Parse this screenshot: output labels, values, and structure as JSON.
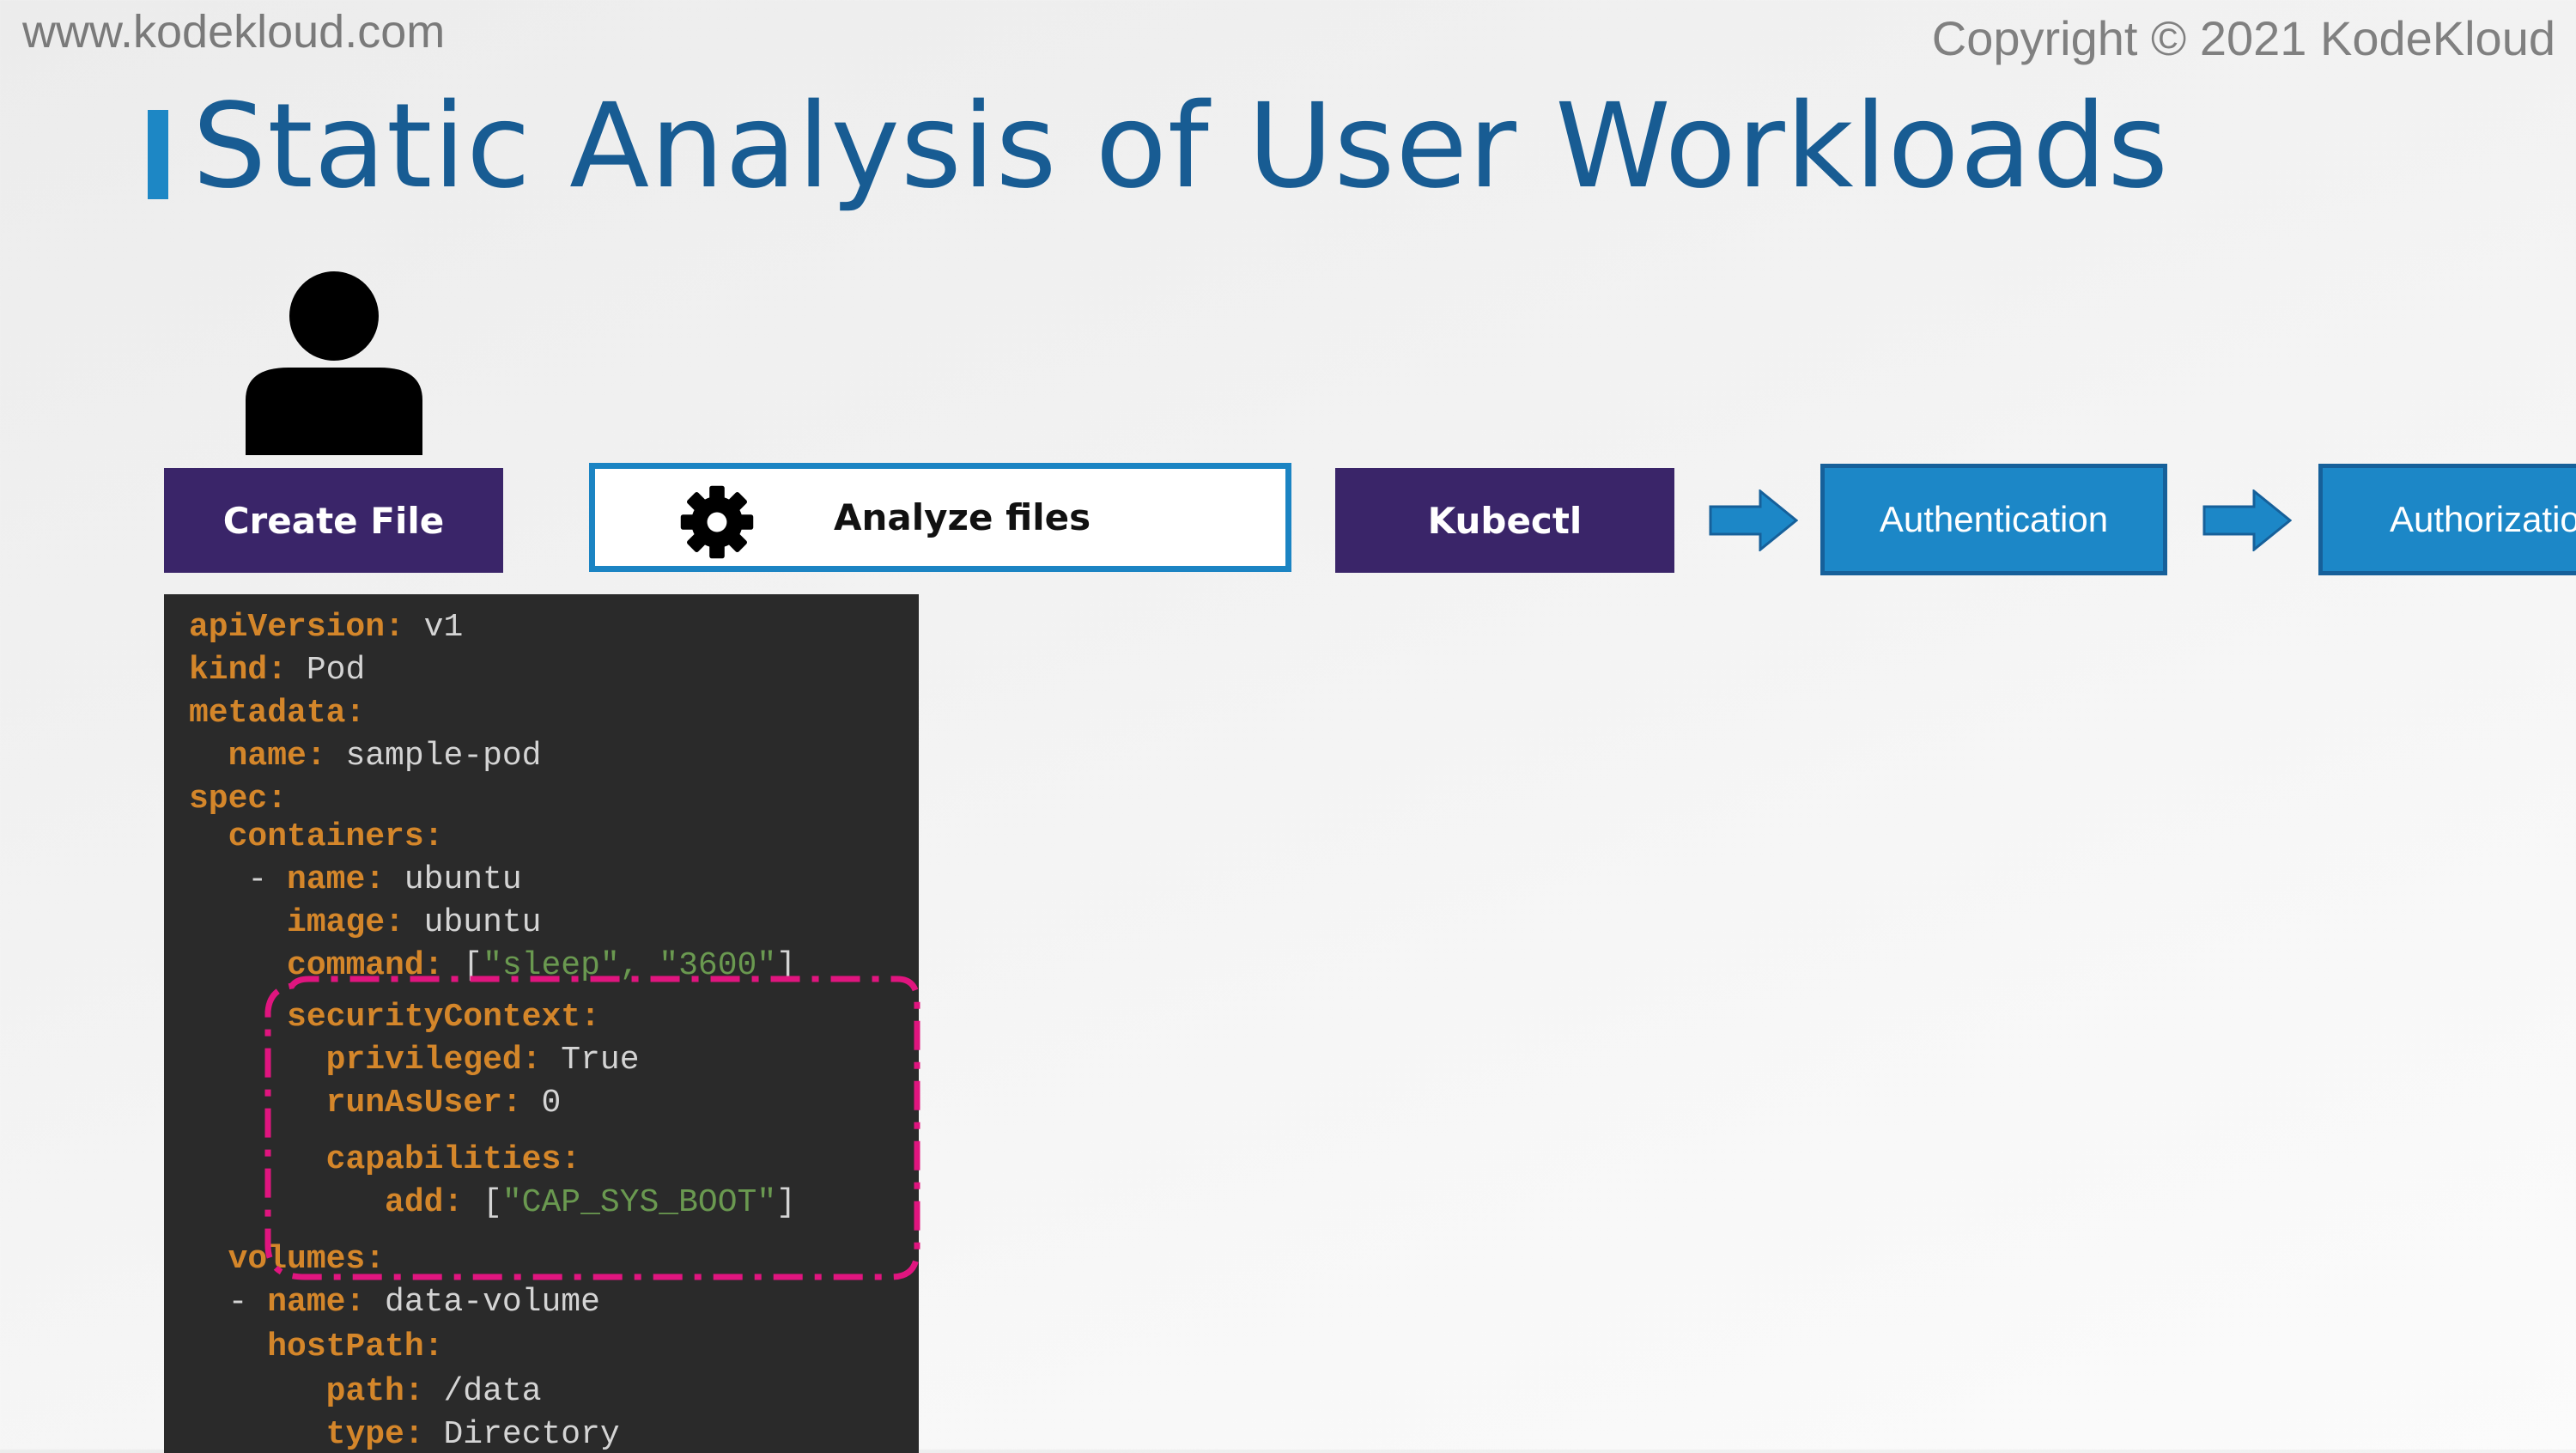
{
  "header": {
    "site_url": "www.kodekloud.com",
    "copyright": "Copyright © 2021 KodeKloud"
  },
  "slide": {
    "title": "Static Analysis of User Workloads"
  },
  "flow": {
    "create_file": "Create File",
    "analyze_files": "Analyze files",
    "kubectl": "Kubectl",
    "authentication": "Authentication",
    "authorization": "Authorizatio"
  },
  "code": {
    "lines": [
      {
        "indent": "",
        "key": "apiVersion:",
        "value": " v1"
      },
      {
        "indent": "",
        "key": "kind:",
        "value": " Pod"
      },
      {
        "indent": "",
        "key": "metadata:",
        "value": ""
      },
      {
        "indent": "  ",
        "key": "name:",
        "value": " sample-pod"
      },
      {
        "indent": "",
        "key": "spec:",
        "value": ""
      },
      {
        "indent": "  ",
        "key": "containers:",
        "value": ""
      },
      {
        "indent": "   - ",
        "key": "name:",
        "value": " ubuntu"
      },
      {
        "indent": "     ",
        "key": "image:",
        "value": " ubuntu"
      },
      {
        "indent": "     ",
        "key": "command:",
        "value_pre": " [",
        "string": "\"sleep\", \"3600\"",
        "value_post": "]"
      },
      {
        "indent": "     ",
        "key": "securityContext:",
        "value": ""
      },
      {
        "indent": "       ",
        "key": "privileged:",
        "value": " True"
      },
      {
        "indent": "       ",
        "key": "runAsUser:",
        "value": " 0"
      },
      {
        "indent": "       ",
        "key": "capabilities:",
        "value": ""
      },
      {
        "indent": "          ",
        "key": "add:",
        "value_pre": " [",
        "string": "\"CAP_SYS_BOOT\"",
        "value_post": "]"
      },
      {
        "indent": "  ",
        "key": "volumes:",
        "value": ""
      },
      {
        "indent": "  - ",
        "key": "name:",
        "value": " data-volume"
      },
      {
        "indent": "    ",
        "key": "hostPath:",
        "value": ""
      },
      {
        "indent": "       ",
        "key": "path:",
        "value": " /data"
      },
      {
        "indent": "       ",
        "key": "type:",
        "value": " Directory"
      }
    ]
  },
  "colors": {
    "title": "#185c93",
    "accent_blue": "#1c87c7",
    "purple": "#3a2569",
    "highlight": "#e0157f",
    "code_key": "#d4862a",
    "code_string": "#6a9950"
  }
}
